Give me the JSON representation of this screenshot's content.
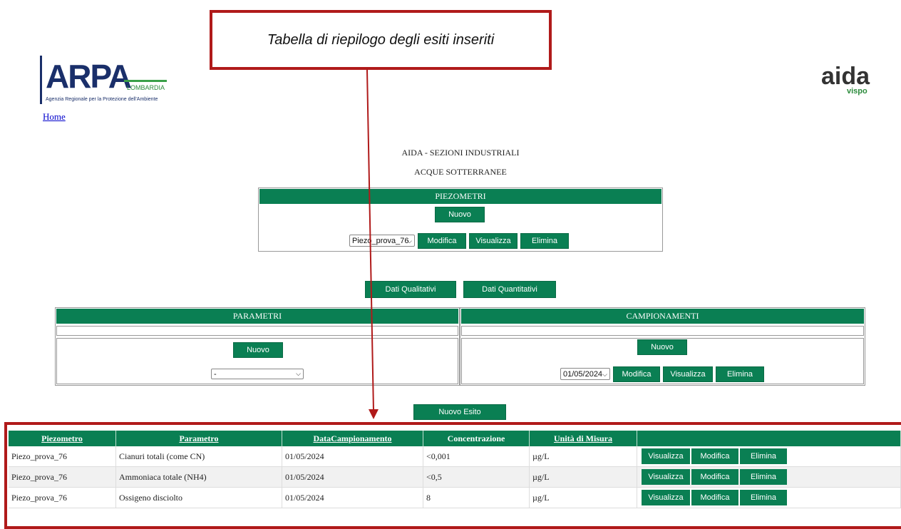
{
  "annotation": {
    "text": "Tabella di riepilogo degli esiti inseriti"
  },
  "logos": {
    "arpa_mark": "ARPA",
    "arpa_region": "LOMBARDIA",
    "arpa_sub": "Agenzia Regionale per la Protezione dell'Ambiente",
    "aida_mark": "aida",
    "aida_sub": "vispo"
  },
  "nav": {
    "home": "Home"
  },
  "page": {
    "title": "AIDA - SEZIONI INDUSTRIALI",
    "subtitle": "ACQUE SOTTERRANEE"
  },
  "piezometri": {
    "header": "PIEZOMETRI",
    "new_label": "Nuovo",
    "selected": "Piezo_prova_76",
    "modify_label": "Modifica",
    "view_label": "Visualizza",
    "delete_label": "Elimina"
  },
  "data_buttons": {
    "qualitative": "Dati Qualitativi",
    "quantitative": "Dati Quantitativi"
  },
  "parametri": {
    "header": "PARAMETRI",
    "new_label": "Nuovo",
    "selected": "-"
  },
  "campionamenti": {
    "header": "CAMPIONAMENTI",
    "new_label": "Nuovo",
    "selected": "01/05/2024",
    "modify_label": "Modifica",
    "view_label": "Visualizza",
    "delete_label": "Elimina"
  },
  "esito": {
    "new_label": "Nuovo Esito"
  },
  "results": {
    "columns": [
      "Piezometro",
      "Parametro",
      "DataCampionamento",
      "Concentrazione",
      "Unità di Misura"
    ],
    "rows": [
      {
        "piezometro": "Piezo_prova_76",
        "parametro": "Cianuri totali (come CN)",
        "data": "01/05/2024",
        "conc": "<0,001",
        "unita": "µg/L"
      },
      {
        "piezometro": "Piezo_prova_76",
        "parametro": "Ammoniaca totale (NH4)",
        "data": "01/05/2024",
        "conc": "<0,5",
        "unita": "µg/L"
      },
      {
        "piezometro": "Piezo_prova_76",
        "parametro": "Ossigeno disciolto",
        "data": "01/05/2024",
        "conc": "8",
        "unita": "µg/L"
      }
    ],
    "view_label": "Visualizza",
    "modify_label": "Modifica",
    "delete_label": "Elimina"
  },
  "colors": {
    "primary": "#0a7f53",
    "annotation": "#b01a1a"
  }
}
